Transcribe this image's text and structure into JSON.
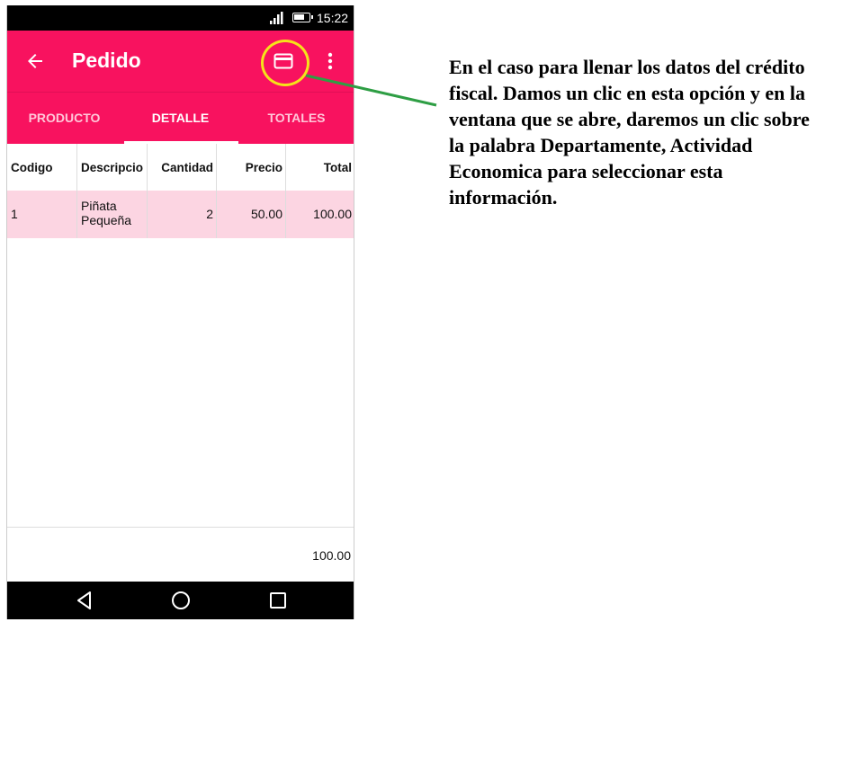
{
  "status_bar": {
    "time": "15:22"
  },
  "appbar": {
    "title": "Pedido",
    "icons": [
      "back-arrow-icon",
      "credit-card-icon",
      "more-vert-icon"
    ]
  },
  "tabs": [
    {
      "label": "PRODUCTO",
      "active": false
    },
    {
      "label": "DETALLE",
      "active": true
    },
    {
      "label": "TOTALES",
      "active": false
    }
  ],
  "table": {
    "columns": [
      "Codigo",
      "Descripcio",
      "Cantidad",
      "Precio",
      "Total"
    ],
    "rows": [
      {
        "codigo": "1",
        "descripcion": "Piñata Pequeña",
        "cantidad": "2",
        "precio": "50.00",
        "total": "100.00"
      }
    ]
  },
  "footer": {
    "total": "100.00"
  },
  "annotation": {
    "text": "En el caso para llenar los datos del crédito fiscal. Damos un clic en esta opción y en la ventana que se abre, daremos un clic sobre la palabra Departamente, Actividad Economica para seleccionar esta información.",
    "highlight_color": "#f5e31a",
    "pointer_color": "#2e9e44"
  },
  "colors": {
    "primary": "#f8125f",
    "row_highlight": "#fcd5e2"
  }
}
